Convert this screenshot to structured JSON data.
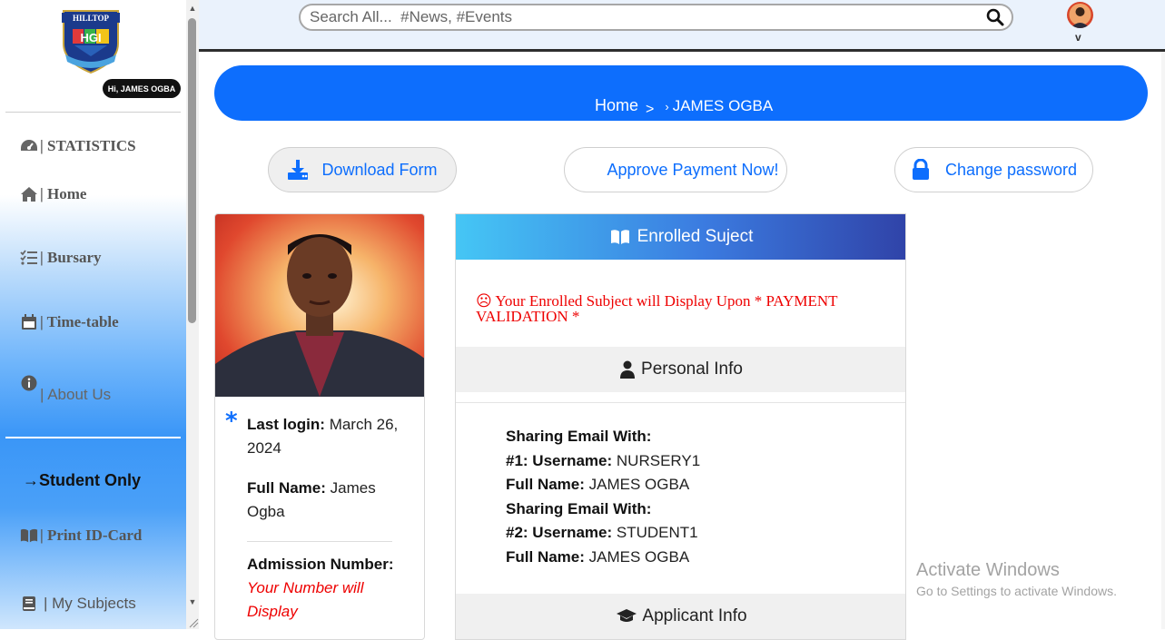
{
  "sidebar": {
    "logo_text": "HILLTOP",
    "logo_initials": "HGI",
    "greeting": "Hi, JAMES OGBA",
    "items": {
      "statistics": "| STATISTICS",
      "home": "| Home",
      "bursary": "| Bursary",
      "timetable": "| Time-table",
      "about": "| About Us",
      "student_only": "→Student Only",
      "print_id": "| Print ID-Card",
      "subjects": "| My Subjects"
    }
  },
  "header": {
    "search_placeholder": "Search All...  #News, #Events"
  },
  "breadcrumb": {
    "home": "Home",
    "sep": ">",
    "sep2": "›",
    "current": "JAMES OGBA"
  },
  "actions": {
    "download": "Download Form",
    "approve": "Approve Payment Now!",
    "change_password": "Change password"
  },
  "profile": {
    "star": "*",
    "last_login_label": "Last login:",
    "last_login_value": "March 26, 2024",
    "full_name_label": "Full Name:",
    "full_name_value": "James Ogba",
    "admission_label": "Admission Number:",
    "admission_value": "Your Number will Display"
  },
  "panel": {
    "enrolled_title": "Enrolled Suject",
    "warning_icon": "☹",
    "warning": "Your Enrolled Subject will Display Upon * PAYMENT VALIDATION *",
    "personal_title": "Personal Info",
    "sharing": [
      {
        "heading": "Sharing Email With:",
        "username_label": "#1: Username:",
        "username": "NURSERY1",
        "fullname_label": "Full Name:",
        "fullname": "JAMES OGBA"
      },
      {
        "heading": "Sharing Email With:",
        "username_label": "#2: Username:",
        "username": "STUDENT1",
        "fullname_label": "Full Name:",
        "fullname": "JAMES OGBA"
      }
    ],
    "applicant_title": "Applicant Info"
  },
  "watermark": {
    "line1": "Activate Windows",
    "line2": "Go to Settings to activate Windows."
  },
  "colors": {
    "primary": "#0d6efd",
    "danger": "#ee0000"
  }
}
